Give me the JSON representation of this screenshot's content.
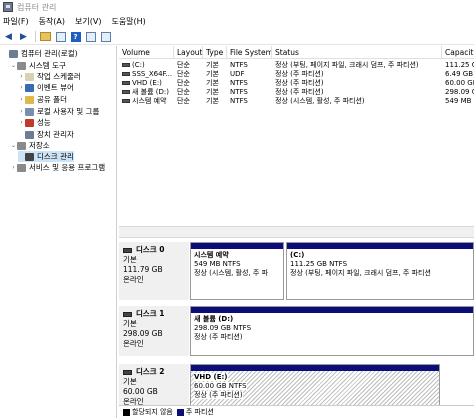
{
  "window": {
    "title": "컴퓨터 관리"
  },
  "menu": [
    "파일(F)",
    "동작(A)",
    "보기(V)",
    "도움말(H)"
  ],
  "tree": [
    {
      "label": "컴퓨터 관리(로컬)",
      "level": 0,
      "twisty": "",
      "icon": "computer-icon",
      "color": "#6b7d93"
    },
    {
      "label": "시스템 도구",
      "level": 1,
      "twisty": "⌄",
      "icon": "tools-icon",
      "color": "#8a8a8a"
    },
    {
      "label": "작업 스케줄러",
      "level": 2,
      "twisty": "›",
      "icon": "clock-icon",
      "color": "#d9d2b0"
    },
    {
      "label": "이벤트 뷰어",
      "level": 2,
      "twisty": "›",
      "icon": "event-viewer-icon",
      "color": "#3a6ab0"
    },
    {
      "label": "공유 폴더",
      "level": 2,
      "twisty": "›",
      "icon": "shared-folder-icon",
      "color": "#e0b84a"
    },
    {
      "label": "로컬 사용자 및 그룹",
      "level": 2,
      "twisty": "›",
      "icon": "users-icon",
      "color": "#7a8fb0"
    },
    {
      "label": "성능",
      "level": 2,
      "twisty": "›",
      "icon": "performance-icon",
      "color": "#c0392b"
    },
    {
      "label": "장치 관리자",
      "level": 2,
      "twisty": "",
      "icon": "device-manager-icon",
      "color": "#6b7d93"
    },
    {
      "label": "저장소",
      "level": 1,
      "twisty": "⌄",
      "icon": "storage-icon",
      "color": "#8a8a8a"
    },
    {
      "label": "디스크 관리",
      "level": 2,
      "twisty": "",
      "icon": "disk-icon",
      "color": "#444444",
      "selected": true
    },
    {
      "label": "서비스 및 응용 프로그램",
      "level": 1,
      "twisty": "›",
      "icon": "services-icon",
      "color": "#8a8a8a"
    }
  ],
  "list": {
    "columns": [
      "Volume",
      "Layout",
      "Type",
      "File System",
      "Status",
      "Capacity"
    ],
    "rows": [
      [
        "(C:)",
        "단순",
        "기본",
        "NTFS",
        "정상 (부팅, 페이지 파일, 크래시 덤프, 주 파티션)",
        "111.25 G"
      ],
      [
        "SSS_X64F...",
        "단순",
        "기본",
        "UDF",
        "정상 (주 파티션)",
        "6.49 GB"
      ],
      [
        "VHD (E:)",
        "단순",
        "기본",
        "NTFS",
        "정상 (주 파티션)",
        "60.00 GB"
      ],
      [
        "새 볼륨 (D:)",
        "단순",
        "기본",
        "NTFS",
        "정상 (주 파티션)",
        "298.09 G"
      ],
      [
        "시스템 예약",
        "단순",
        "기본",
        "NTFS",
        "정상 (시스템, 활성, 주 파티션)",
        "549 MB"
      ]
    ]
  },
  "disks": [
    {
      "name": "디스크 0",
      "type": "기본",
      "size": "111.79 GB",
      "state": "온라인",
      "partitions": [
        {
          "name": "시스템 예약",
          "size": "549 MB NTFS",
          "status": "정상 (시스템, 활성, 주 파"
        },
        {
          "name": "(C:)",
          "size": "111.25 GB NTFS",
          "status": "정상 (부팅, 페이지 파일, 크래시 덤프, 주 파티션"
        }
      ]
    },
    {
      "name": "디스크 1",
      "type": "기본",
      "size": "298.09 GB",
      "state": "온라인",
      "partitions": [
        {
          "name": "새 볼륨 (D:)",
          "size": "298.09 GB NTFS",
          "status": "정상 (주 파티션)"
        }
      ]
    },
    {
      "name": "디스크 2",
      "type": "기본",
      "size": "60.00 GB",
      "state": "온라인",
      "partitions": [
        {
          "name": "VHD (E:)",
          "size": "60.00 GB NTFS",
          "status": "정상 (주 파티션)"
        }
      ]
    }
  ],
  "legend": [
    {
      "label": "할당되지 않음",
      "color": "#000000"
    },
    {
      "label": "주 파티션",
      "color": "#0c0c7a"
    }
  ]
}
